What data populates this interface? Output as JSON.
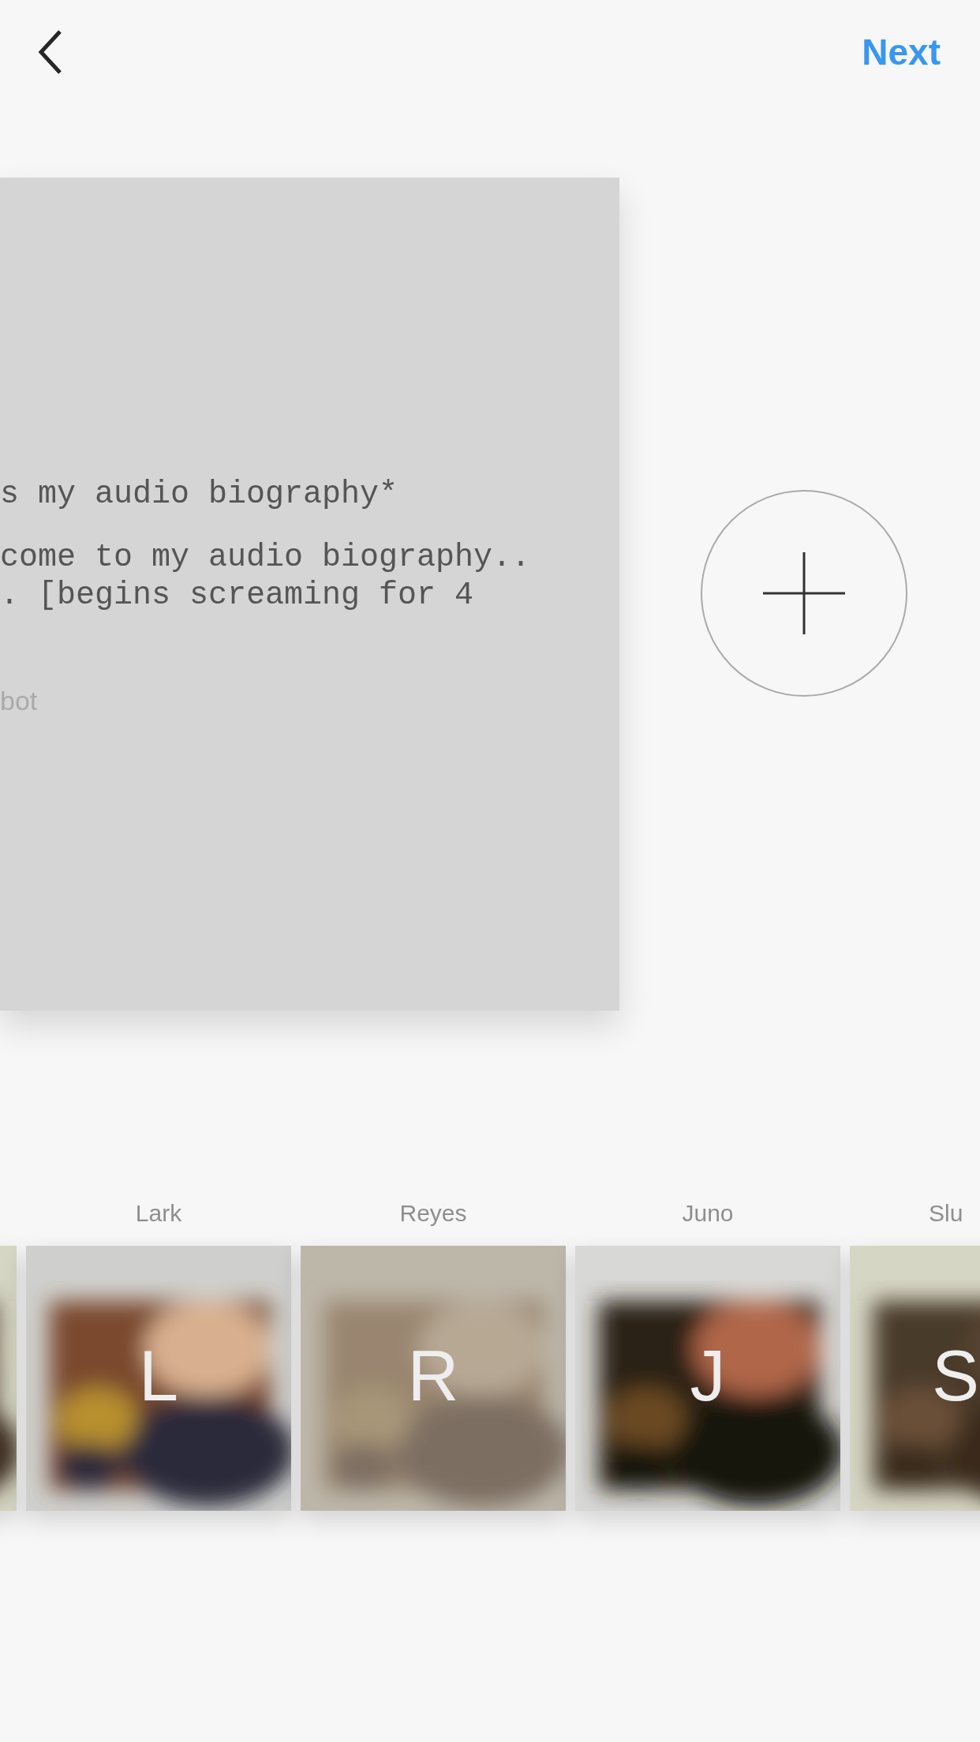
{
  "header": {
    "next": "Next"
  },
  "card": {
    "lines": [
      "s my audio biography*",
      "come to my audio biography..",
      ". [begins screaming for 4"
    ],
    "footer": "bot"
  },
  "filters": [
    {
      "kind": "partial"
    },
    {
      "kind": "full",
      "name": "Lark",
      "letter": "L"
    },
    {
      "kind": "full",
      "name": "Reyes",
      "letter": "R"
    },
    {
      "kind": "full",
      "name": "Juno",
      "letter": "J"
    },
    {
      "kind": "edge",
      "name": "Slu",
      "letter": "S"
    }
  ]
}
